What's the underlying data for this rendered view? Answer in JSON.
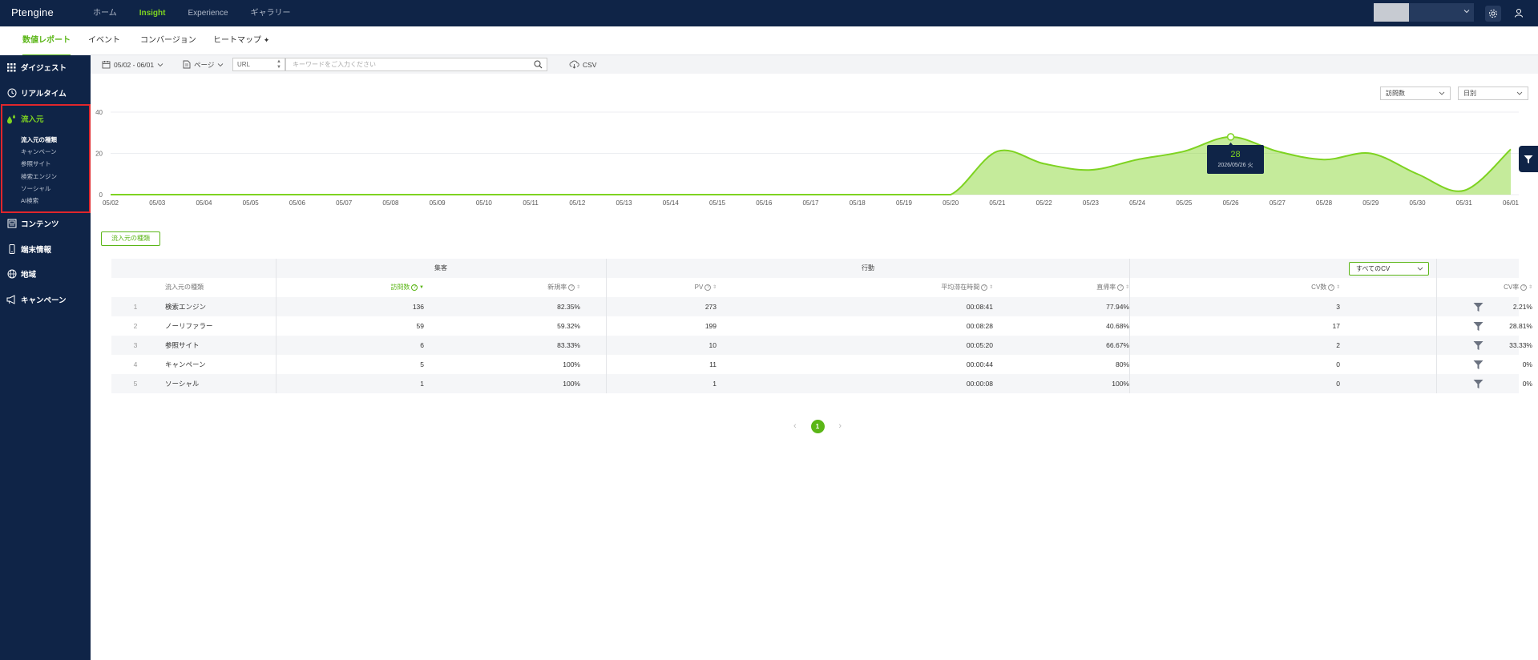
{
  "app": {
    "logo": "Ptengine"
  },
  "topnav": [
    "ホーム",
    "Insight",
    "Experience",
    "ギャラリー"
  ],
  "topnav_active": "Insight",
  "subnav": [
    "数値レポート",
    "イベント",
    "コンバージョン",
    "ヒートマップ"
  ],
  "sidebar": {
    "items": [
      {
        "label": "ダイジェスト",
        "icon": "grid-icon"
      },
      {
        "label": "リアルタイム",
        "icon": "clock-icon"
      },
      {
        "label": "流入元",
        "icon": "drops-icon"
      },
      {
        "label": "コンテンツ",
        "icon": "content-icon"
      },
      {
        "label": "端末情報",
        "icon": "device-icon"
      },
      {
        "label": "地域",
        "icon": "globe-icon"
      },
      {
        "label": "キャンペーン",
        "icon": "megaphone-icon"
      }
    ],
    "sub_items": [
      "流入元の種類",
      "キャンペーン",
      "参照サイト",
      "検索エンジン",
      "ソーシャル",
      "AI検索"
    ]
  },
  "toolbar": {
    "date_range": "05/02 - 06/01",
    "page_label": "ページ",
    "url_select": "URL",
    "keyword_placeholder": "キーワードをご入力ください",
    "csv_label": "CSV"
  },
  "chart_controls": {
    "metric": "訪問数",
    "granularity": "日別"
  },
  "chart_data": {
    "type": "area",
    "x": [
      "05/02",
      "05/03",
      "05/04",
      "05/05",
      "05/06",
      "05/07",
      "05/08",
      "05/09",
      "05/10",
      "05/11",
      "05/12",
      "05/13",
      "05/14",
      "05/15",
      "05/16",
      "05/17",
      "05/18",
      "05/19",
      "05/20",
      "05/21",
      "05/22",
      "05/23",
      "05/24",
      "05/25",
      "05/26",
      "05/27",
      "05/28",
      "05/29",
      "05/30",
      "05/31",
      "06/01"
    ],
    "series": [
      {
        "values": [
          0,
          0,
          0,
          0,
          0,
          0,
          0,
          0,
          0,
          0,
          0,
          0,
          0,
          0,
          0,
          0,
          0,
          0,
          0,
          21,
          15,
          12,
          17,
          21,
          28,
          21,
          17,
          20,
          10,
          2,
          22
        ]
      }
    ],
    "ylim": [
      0,
      40
    ],
    "yticks": [
      0,
      20,
      40
    ],
    "grid": true,
    "color": "#7ed321",
    "tooltip": {
      "value": "28",
      "label": "2026/05/26 火",
      "index": 24
    }
  },
  "source_button": "流入元の種類",
  "table": {
    "groups": {
      "acquisition": "集客",
      "behavior": "行動",
      "cv_select": "すべてのCV"
    },
    "columns": [
      "流入元の種類",
      "訪問数",
      "新規率",
      "PV",
      "平均滞在時間",
      "直帰率",
      "CV数",
      "CV率"
    ],
    "rows": [
      {
        "rank": "1",
        "name": "検索エンジン",
        "visits": "136",
        "new_rate": "82.35%",
        "pv": "273",
        "avg_time": "00:08:41",
        "bounce": "77.94%",
        "cv": "3",
        "cv_rate": "2.21%"
      },
      {
        "rank": "2",
        "name": "ノーリファラー",
        "visits": "59",
        "new_rate": "59.32%",
        "pv": "199",
        "avg_time": "00:08:28",
        "bounce": "40.68%",
        "cv": "17",
        "cv_rate": "28.81%"
      },
      {
        "rank": "3",
        "name": "参照サイト",
        "visits": "6",
        "new_rate": "83.33%",
        "pv": "10",
        "avg_time": "00:05:20",
        "bounce": "66.67%",
        "cv": "2",
        "cv_rate": "33.33%"
      },
      {
        "rank": "4",
        "name": "キャンペーン",
        "visits": "5",
        "new_rate": "100%",
        "pv": "11",
        "avg_time": "00:00:44",
        "bounce": "80%",
        "cv": "0",
        "cv_rate": "0%"
      },
      {
        "rank": "5",
        "name": "ソーシャル",
        "visits": "1",
        "new_rate": "100%",
        "pv": "1",
        "avg_time": "00:00:08",
        "bounce": "100%",
        "cv": "0",
        "cv_rate": "0%"
      }
    ]
  },
  "pagination": {
    "current": "1"
  },
  "colors": {
    "nav_bg": "#0f2447",
    "accent": "#7ed321",
    "accent_dark": "#5bb617",
    "highlight_box": "#e0262b"
  }
}
